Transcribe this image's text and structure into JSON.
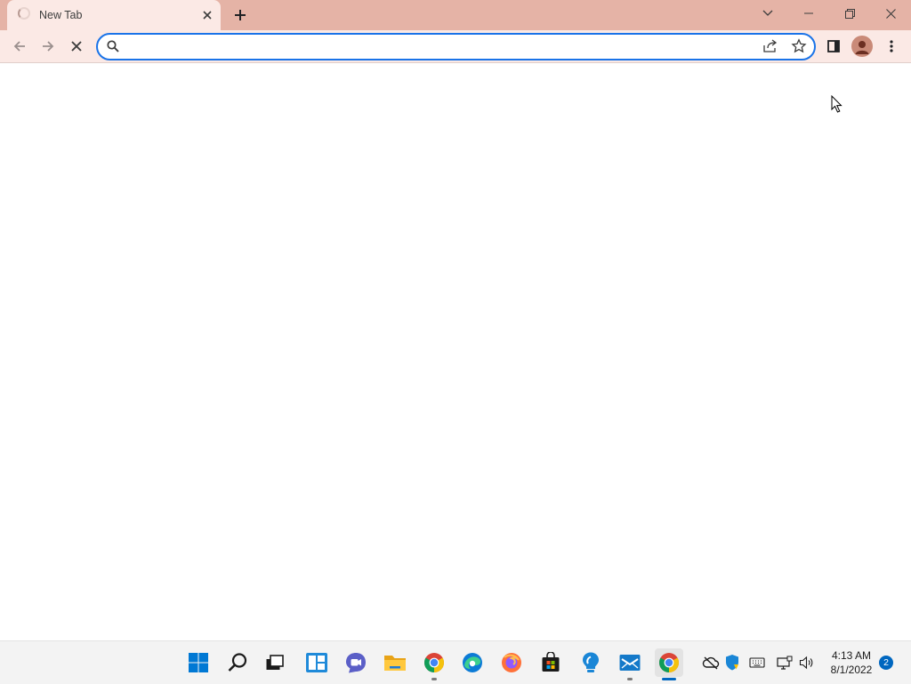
{
  "browser": {
    "tab": {
      "title": "New Tab",
      "loading": true
    },
    "omnibox": {
      "value": "",
      "placeholder": ""
    },
    "colors": {
      "frame": "#e5b3a6",
      "toolbar": "#fbe9e5",
      "focus_ring": "#1a73e8"
    }
  },
  "taskbar": {
    "apps": [
      {
        "name": "Start",
        "icon": "windows-logo"
      },
      {
        "name": "Search",
        "icon": "search-icon"
      },
      {
        "name": "Task View",
        "icon": "task-view-icon"
      },
      {
        "name": "Widgets",
        "icon": "widgets-icon"
      },
      {
        "name": "Chat",
        "icon": "chat-icon"
      },
      {
        "name": "File Explorer",
        "icon": "folder-icon"
      },
      {
        "name": "Google Chrome",
        "icon": "chrome-icon"
      },
      {
        "name": "Microsoft Edge",
        "icon": "edge-icon"
      },
      {
        "name": "Firefox",
        "icon": "firefox-icon"
      },
      {
        "name": "Microsoft Store",
        "icon": "store-icon"
      },
      {
        "name": "Tips",
        "icon": "lightbulb-icon"
      },
      {
        "name": "Mail",
        "icon": "mail-icon"
      },
      {
        "name": "Google Chrome",
        "icon": "chrome-icon",
        "active": true
      }
    ],
    "clock": {
      "time": "4:13 AM",
      "date": "8/1/2022"
    },
    "notifications": "2"
  }
}
